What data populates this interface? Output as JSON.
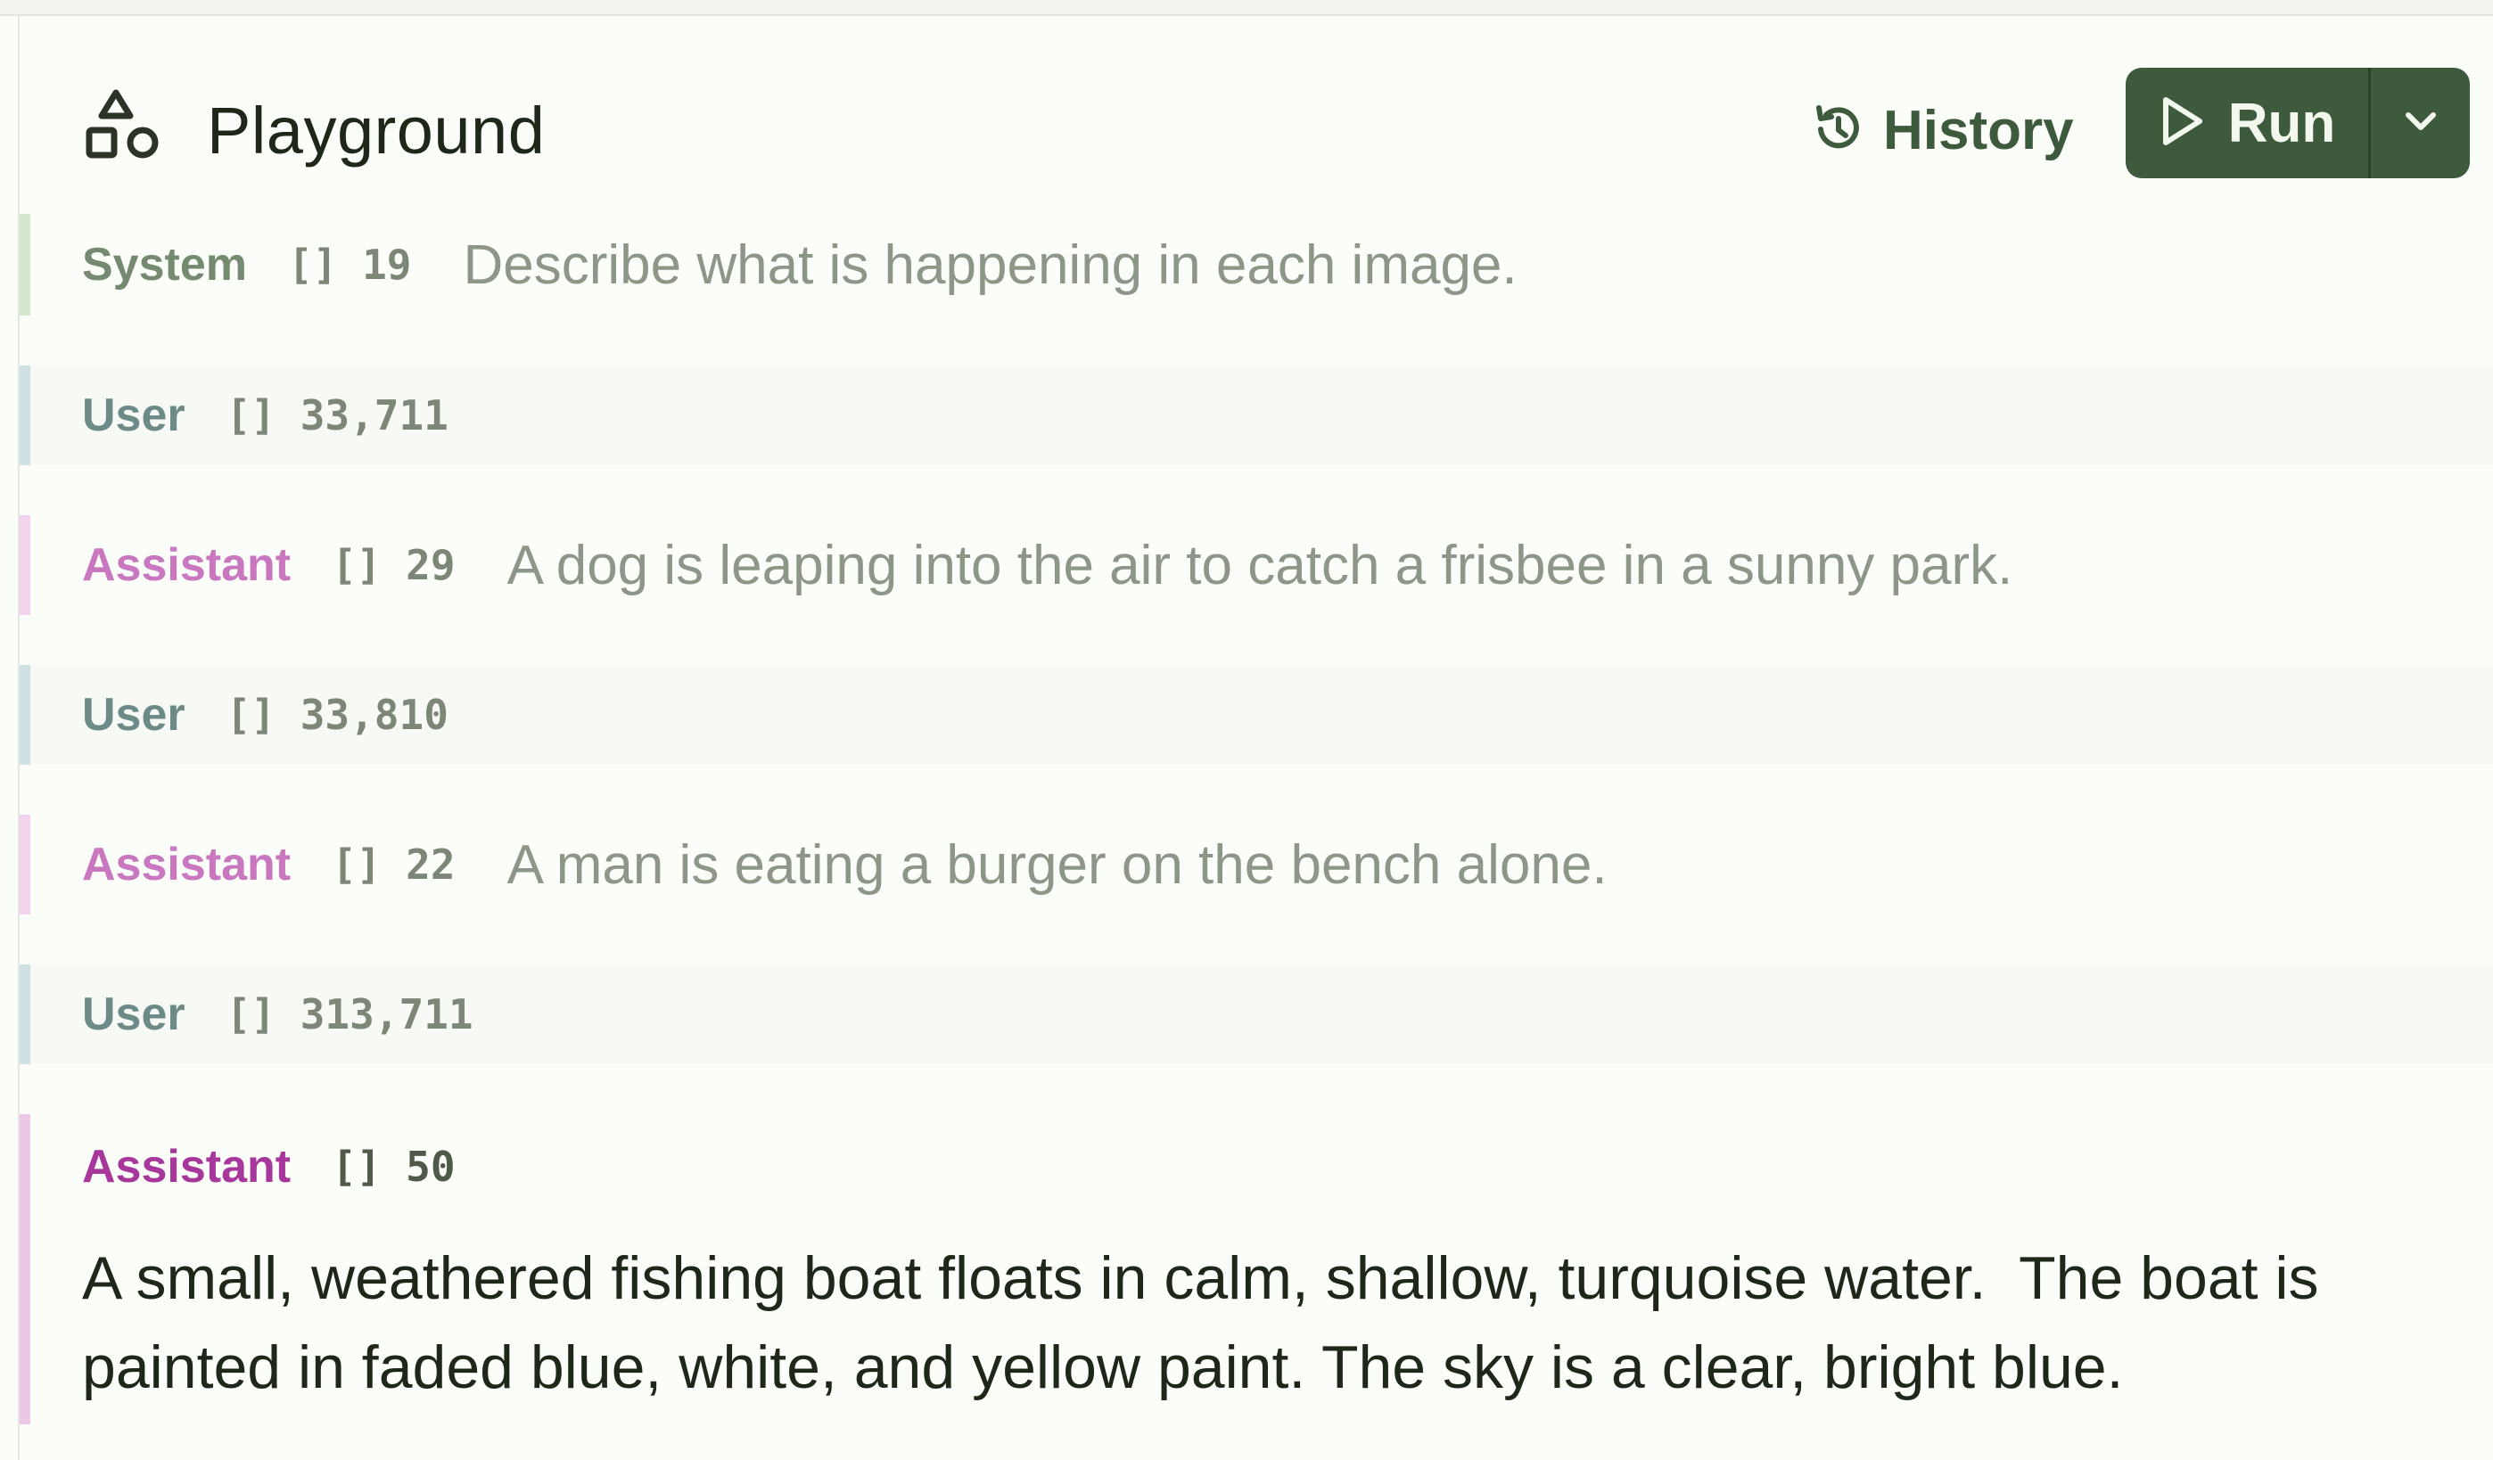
{
  "header": {
    "title": "Playground",
    "brand_icon": "shapes-icon",
    "history_label": "History",
    "history_icon": "history-icon",
    "run_label": "Run",
    "run_icon": "play-icon",
    "run_menu_icon": "chevron-down-icon"
  },
  "colors": {
    "accent": "#3d5b3c",
    "system_bar": "#d6e5cf",
    "user_bar": "#cfe2e3",
    "assistant_bar": "#f2d2ec",
    "assistant_role": "#c977bf",
    "assistant_role_active": "#a8379c"
  },
  "messages": [
    {
      "role": "System",
      "tokens": "[] 19",
      "text": "Describe what is happening in each image."
    },
    {
      "role": "User",
      "tokens": "[] 33,711",
      "text": ""
    },
    {
      "role": "Assistant",
      "tokens": "[] 29",
      "text": "A dog is leaping into the air to catch a frisbee in a sunny park."
    },
    {
      "role": "User",
      "tokens": "[] 33,810",
      "text": ""
    },
    {
      "role": "Assistant",
      "tokens": "[] 22",
      "text": "A man is eating a burger on the bench alone."
    },
    {
      "role": "User",
      "tokens": "[] 313,711",
      "text": ""
    },
    {
      "role": "Assistant",
      "tokens": "[] 50",
      "text": "A small, weathered fishing boat floats in calm, shallow, turquoise water.  The boat is painted in faded blue, white, and yellow paint. The sky is a clear, bright blue."
    }
  ]
}
